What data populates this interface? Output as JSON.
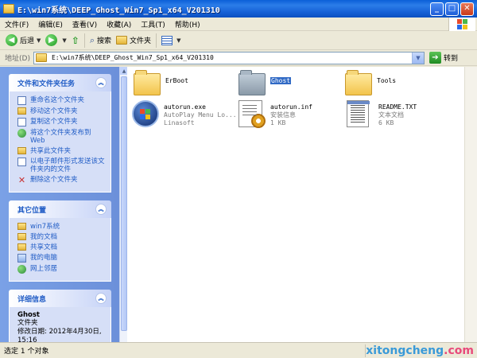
{
  "window": {
    "title": "E:\\win7系统\\DEEP_Ghost_Win7_Sp1_x64_V201310",
    "min_glyph": "_",
    "max_glyph": "□",
    "close_glyph": "✕"
  },
  "menu": [
    "文件(F)",
    "编辑(E)",
    "查看(V)",
    "收藏(A)",
    "工具(T)",
    "帮助(H)"
  ],
  "toolbar": {
    "back": "后退",
    "search": "搜索",
    "folders": "文件夹"
  },
  "address": {
    "label": "地址(D)",
    "path": "E:\\win7系统\\DEEP_Ghost_Win7_Sp1_x64_V201310",
    "go": "转到"
  },
  "tasks_panel": {
    "title": "文件和文件夹任务",
    "items": [
      "重命名这个文件夹",
      "移动这个文件夹",
      "复制这个文件夹",
      "将这个文件夹发布到 Web",
      "共享此文件夹",
      "以电子邮件形式发送该文件夹内的文件",
      "删除这个文件夹"
    ]
  },
  "places_panel": {
    "title": "其它位置",
    "items": [
      "win7系统",
      "我的文档",
      "共享文档",
      "我的电脑",
      "网上邻居"
    ]
  },
  "details_panel": {
    "title": "详细信息",
    "name": "Ghost",
    "type": "文件夹",
    "modified": "修改日期: 2012年4月30日, 15:16"
  },
  "files": [
    {
      "name": "ErBoot",
      "line2": "",
      "line3": ""
    },
    {
      "name": "Ghost",
      "line2": "",
      "line3": ""
    },
    {
      "name": "Tools",
      "line2": "",
      "line3": ""
    },
    {
      "name": "autorun.exe",
      "line2": "AutoPlay Menu Lo...",
      "line3": "Linasoft"
    },
    {
      "name": "autorun.inf",
      "line2": "安装信息",
      "line3": "1 KB"
    },
    {
      "name": "README.TXT",
      "line2": "文本文档",
      "line3": "6 KB"
    }
  ],
  "status": {
    "text": "选定 1 个对象",
    "watermark_a": "xitongcheng",
    "watermark_b": ".com"
  }
}
